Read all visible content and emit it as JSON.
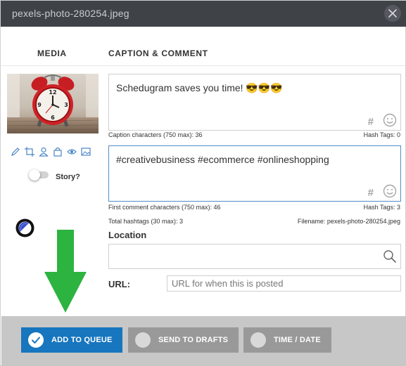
{
  "window": {
    "title": "pexels-photo-280254.jpeg"
  },
  "columns": {
    "media": "MEDIA",
    "caption": "CAPTION & COMMENT"
  },
  "media": {
    "tools": [
      "edit-icon",
      "crop-icon",
      "user-tag-icon",
      "shopping-bag-icon",
      "eye-icon",
      "image-icon"
    ],
    "story_label": "Story?",
    "story_enabled": false
  },
  "caption": {
    "text": "Schedugram saves you time! 😎😎😎",
    "hash_symbol": "#",
    "chars_label": "Caption characters (750 max): 36",
    "hashtags_label": "Hash Tags: 0"
  },
  "comment": {
    "text": "#creativebusiness #ecommerce #onlineshopping",
    "hash_symbol": "#",
    "chars_label": "First comment characters (750 max): 46",
    "hashtags_label": "Hash Tags: 3"
  },
  "totals": {
    "hashtags_label": "Total hashtags (30 max): 3",
    "filename_label": "Filename: pexels-photo-280254.jpeg"
  },
  "location": {
    "label": "Location",
    "value": ""
  },
  "url": {
    "label": "URL:",
    "placeholder": "URL for when this is posted",
    "value": ""
  },
  "footer": {
    "add_to_queue": "ADD TO QUEUE",
    "send_to_drafts": "SEND TO DRAFTS",
    "time_date": "TIME / DATE"
  },
  "colors": {
    "titlebar": "#3f4247",
    "primary": "#1776be",
    "secondary_button": "#999999",
    "footer": "#c7c7c7",
    "arrow": "#2db340",
    "focus_border": "#4f8cc9"
  }
}
